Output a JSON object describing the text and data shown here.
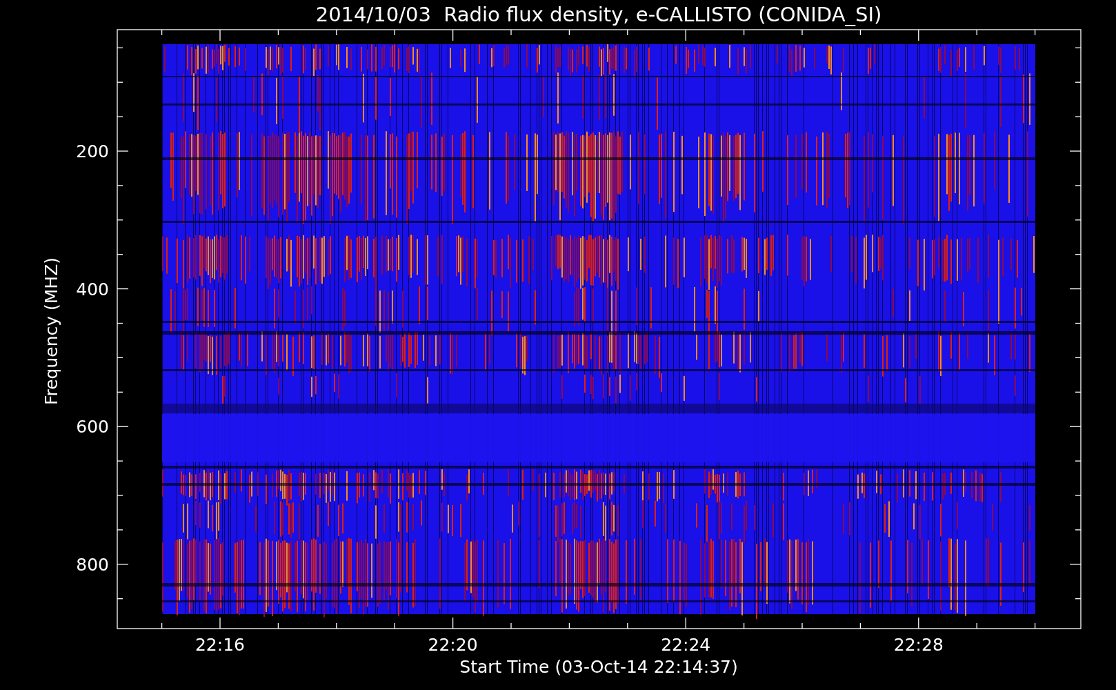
{
  "title": "2014/10/03  Radio flux density, e-CALLISTO (CONIDA_SI)",
  "y_axis": {
    "label": "Frequency (MHZ)",
    "ticks": [
      "200",
      "400",
      "600",
      "800"
    ]
  },
  "x_axis": {
    "label": "Start Time (03-Oct-14 22:14:37)",
    "ticks": [
      "22:16",
      "22:20",
      "22:24",
      "22:28"
    ]
  }
}
